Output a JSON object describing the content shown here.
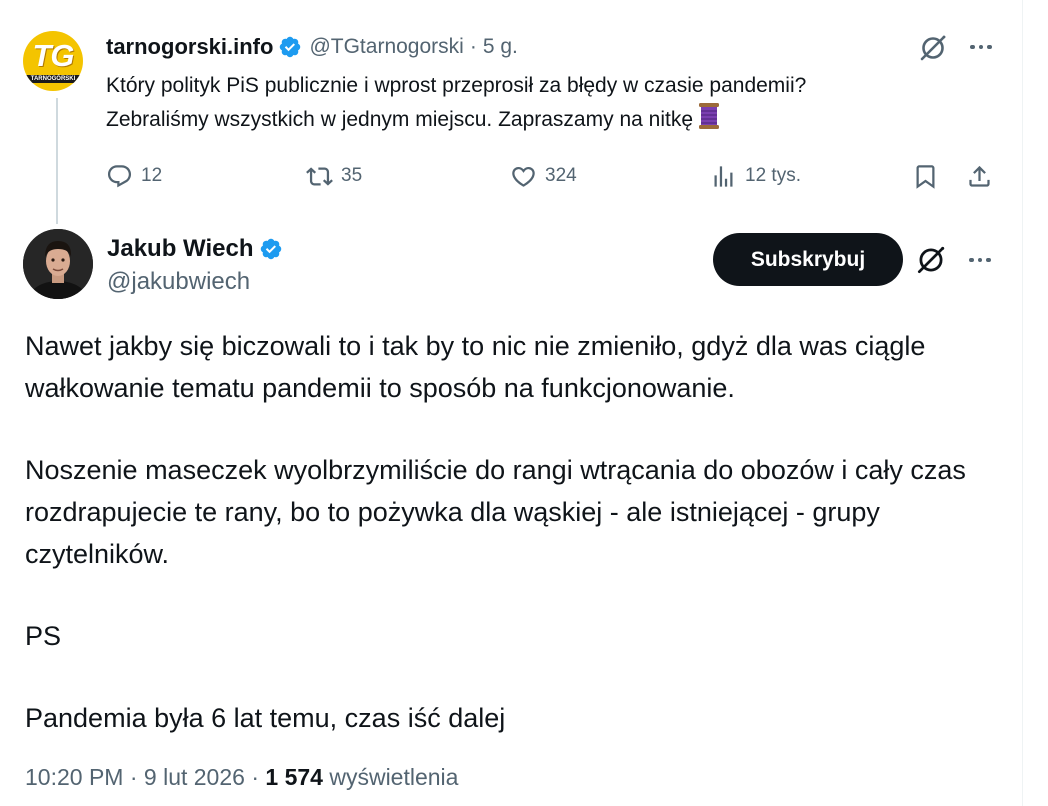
{
  "parent_tweet": {
    "avatar_text": "TG",
    "avatar_subtext": "TARNOGÓRSKI",
    "name": "tarnogorski.info",
    "handle": "@TGtarnogorski",
    "separator": "·",
    "time": "5 g.",
    "text_line1": "Który polityk PiS publicznie i wprost przeprosił za błędy w czasie pandemii?",
    "text_line2": "Zebraliśmy wszystkich w jednym miejscu. Zapraszamy na nitkę",
    "emoji_icon": "thread-spool-icon",
    "replies": "12",
    "retweets": "35",
    "likes": "324",
    "views": "12 tys."
  },
  "main_tweet": {
    "name": "Jakub Wiech",
    "handle": "@jakubwiech",
    "subscribe_label": "Subskrybuj",
    "paragraphs": [
      "Nawet jakby się biczowali to i tak by to nic nie zmieniło, gdyż dla was ciągle wałkowanie tematu pandemii to sposób na funkcjonowanie.",
      "Noszenie maseczek wyolbrzymiliście do rangi wtrącania do obozów i cały czas rozdrapujecie te rany, bo to pożywka dla wąskiej - ale istniejącej - grupy czytelników.",
      "PS",
      "Pandemia była 6 lat temu, czas iść dalej"
    ],
    "time": "10:20 PM",
    "date": "9 lut 2026",
    "separator": "·",
    "views_count": "1 574",
    "views_label": "wyświetlenia"
  },
  "colors": {
    "text": "#0f1419",
    "secondary": "#536471",
    "verified": "#1d9bf0",
    "button_bg": "#0f1419",
    "thread_line": "#cfd9de",
    "avatar_yellow": "#f4c400"
  }
}
